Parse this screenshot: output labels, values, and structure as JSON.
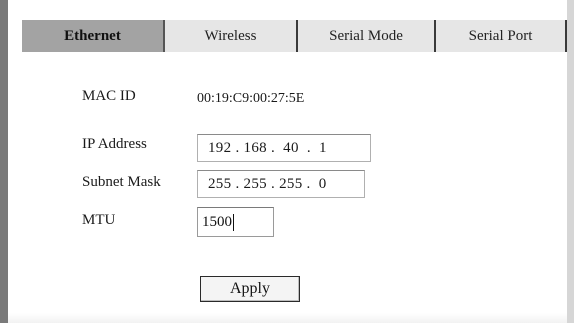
{
  "tabs": [
    {
      "label": "Ethernet",
      "active": true
    },
    {
      "label": "Wireless",
      "active": false
    },
    {
      "label": "Serial Mode",
      "active": false
    },
    {
      "label": "Serial Port",
      "active": false
    }
  ],
  "form": {
    "mac": {
      "label": "MAC ID",
      "value": "00:19:C9:00:27:5E"
    },
    "ip": {
      "label": "IP Address",
      "value": "192 . 168 .  40  .  1"
    },
    "subnet": {
      "label": "Subnet Mask",
      "value": "255 . 255 . 255 .  0"
    },
    "mtu": {
      "label": "MTU",
      "value": "1500"
    },
    "apply_label": "Apply"
  },
  "colors": {
    "active_tab": "#a3a3a3",
    "inactive_tab": "#e6e6e6",
    "left_rail": "#7a7a7a"
  }
}
